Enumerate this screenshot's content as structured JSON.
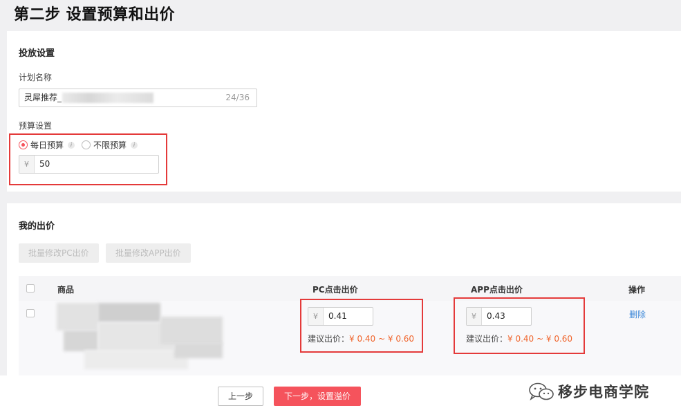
{
  "page": {
    "title": "第二步 设置预算和出价"
  },
  "launch": {
    "section_title": "投放设置",
    "plan_name_label": "计划名称",
    "plan_name_value": "灵犀推荐_",
    "plan_name_counter": "24/36",
    "budget_label": "预算设置",
    "budget_options": [
      {
        "label": "每日预算",
        "checked": true
      },
      {
        "label": "不限预算",
        "checked": false
      }
    ],
    "info_glyph": "i",
    "currency": "¥",
    "budget_value": "50"
  },
  "bid": {
    "section_title": "我的出价",
    "batch_pc_label": "批量修改PC出价",
    "batch_app_label": "批量修改APP出价",
    "columns": [
      "商品",
      "PC点击出价",
      "APP点击出价",
      "操作"
    ],
    "rows": [
      {
        "pc_bid": "0.41",
        "pc_suggest_label": "建议出价：",
        "pc_suggest_range": "¥ 0.40 ~ ¥ 0.60",
        "app_bid": "0.43",
        "app_suggest_label": "建议出价：",
        "app_suggest_range": "¥ 0.40 ~ ¥ 0.60",
        "action": "删除"
      }
    ]
  },
  "footer": {
    "prev_label": "上一步",
    "next_label": "下一步，设置溢价"
  },
  "watermark": {
    "text": "移步电商学院",
    "icon": "wechat-icon"
  },
  "colors": {
    "accent": "#f5535c",
    "highlight": "#e43a3a",
    "suggest_range": "#f0642b",
    "link": "#3b87d8"
  }
}
